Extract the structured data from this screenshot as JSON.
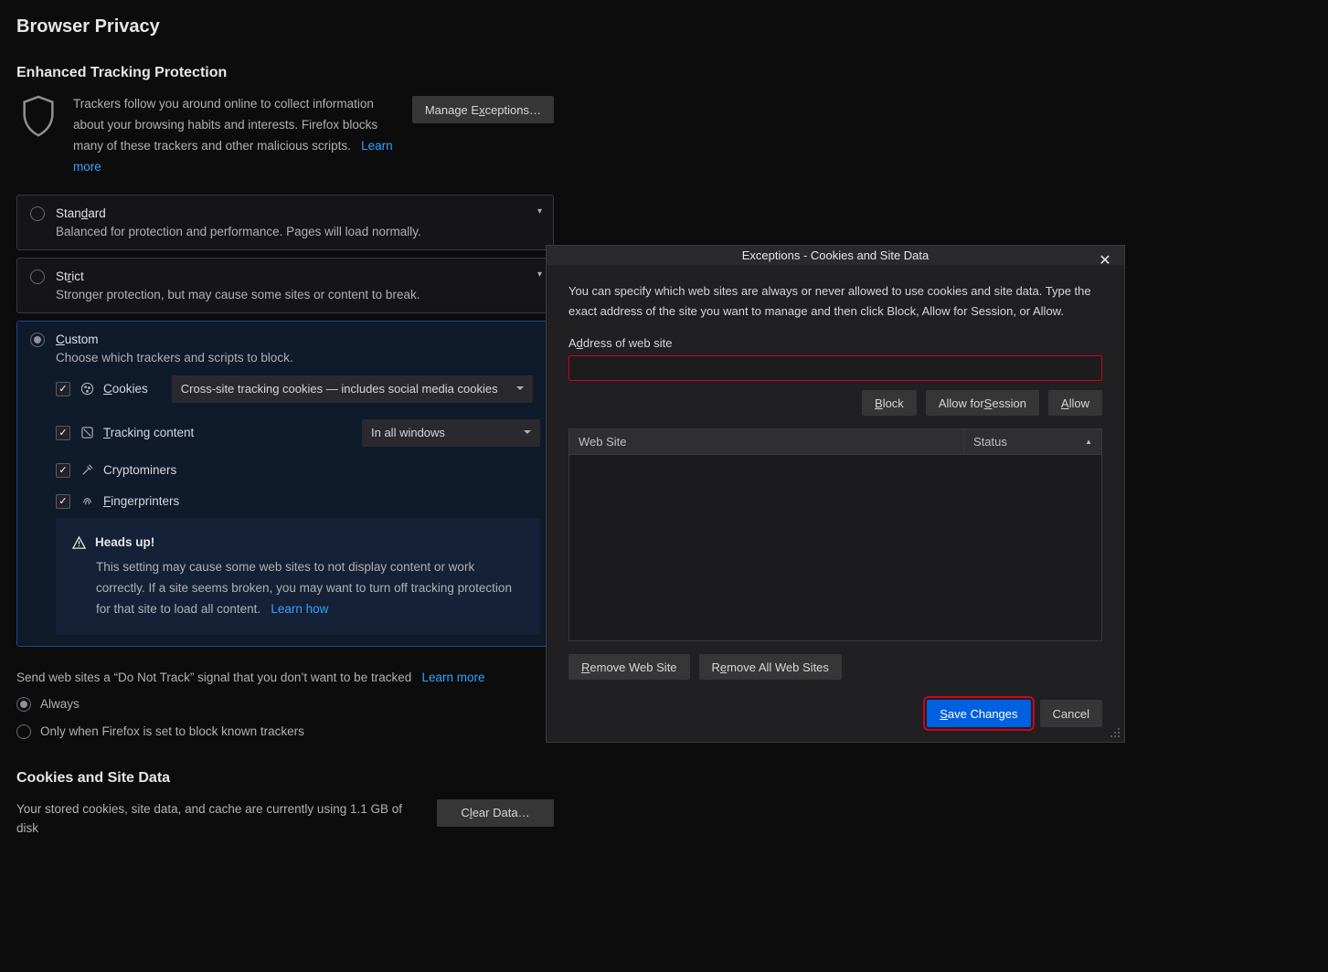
{
  "page": {
    "title": "Browser Privacy"
  },
  "etp": {
    "heading": "Enhanced Tracking Protection",
    "description": "Trackers follow you around online to collect information about your browsing habits and interests. Firefox blocks many of these trackers and other malicious scripts.",
    "learn_more": "Learn more",
    "manage_exceptions": "Manage Exceptions…",
    "standard": {
      "label": "Standard",
      "sub": "Balanced for protection and performance. Pages will load normally."
    },
    "strict": {
      "label": "Strict",
      "sub": "Stronger protection, but may cause some sites or content to break."
    },
    "custom": {
      "label": "Custom",
      "sub": "Choose which trackers and scripts to block.",
      "cookies_label": "Cookies",
      "cookies_dd": "Cross-site tracking cookies — includes social media cookies",
      "tracking_label": "Tracking content",
      "tracking_dd": "In all windows",
      "crypto_label": "Cryptominers",
      "finger_label": "Fingerprinters"
    },
    "heads_up": {
      "title": "Heads up!",
      "body": "This setting may cause some web sites to not display content or work correctly. If a site seems broken, you may want to turn off tracking protection for that site to load all content.",
      "learn_how": "Learn how"
    }
  },
  "dnt": {
    "line": "Send web sites a “Do Not Track” signal that you don’t want to be tracked",
    "learn_more": "Learn more",
    "opt_always": "Always",
    "opt_block": "Only when Firefox is set to block known trackers"
  },
  "cookies": {
    "heading": "Cookies and Site Data",
    "line": "Your stored cookies, site data, and cache are currently using 1.1 GB of disk",
    "clear_btn": "Clear Data…"
  },
  "dialog": {
    "title": "Exceptions - Cookies and Site Data",
    "description": "You can specify which web sites are always or never allowed to use cookies and site data. Type the exact address of the site you want to manage and then click Block, Allow for Session, or Allow.",
    "address_label": "Address of web site",
    "address_value": "",
    "block": "Block",
    "allow_session": "Allow for Session",
    "allow": "Allow",
    "col_website": "Web Site",
    "col_status": "Status",
    "remove": "Remove Web Site",
    "remove_all": "Remove All Web Sites",
    "save": "Save Changes",
    "cancel": "Cancel"
  }
}
